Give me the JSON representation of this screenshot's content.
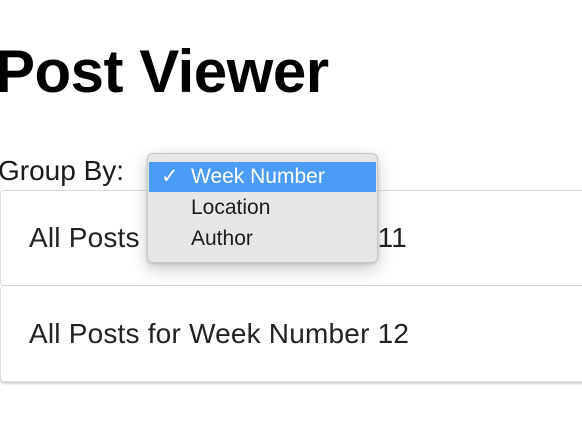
{
  "page": {
    "title": "Post Viewer"
  },
  "group_by": {
    "label": "Group By:",
    "options": [
      "Week Number",
      "Location",
      "Author"
    ],
    "selected": "Week Number"
  },
  "groups": [
    {
      "label": "All Posts for Week Number 11"
    },
    {
      "label": "All Posts for Week Number 12"
    }
  ],
  "icons": {
    "check": "check-icon"
  }
}
